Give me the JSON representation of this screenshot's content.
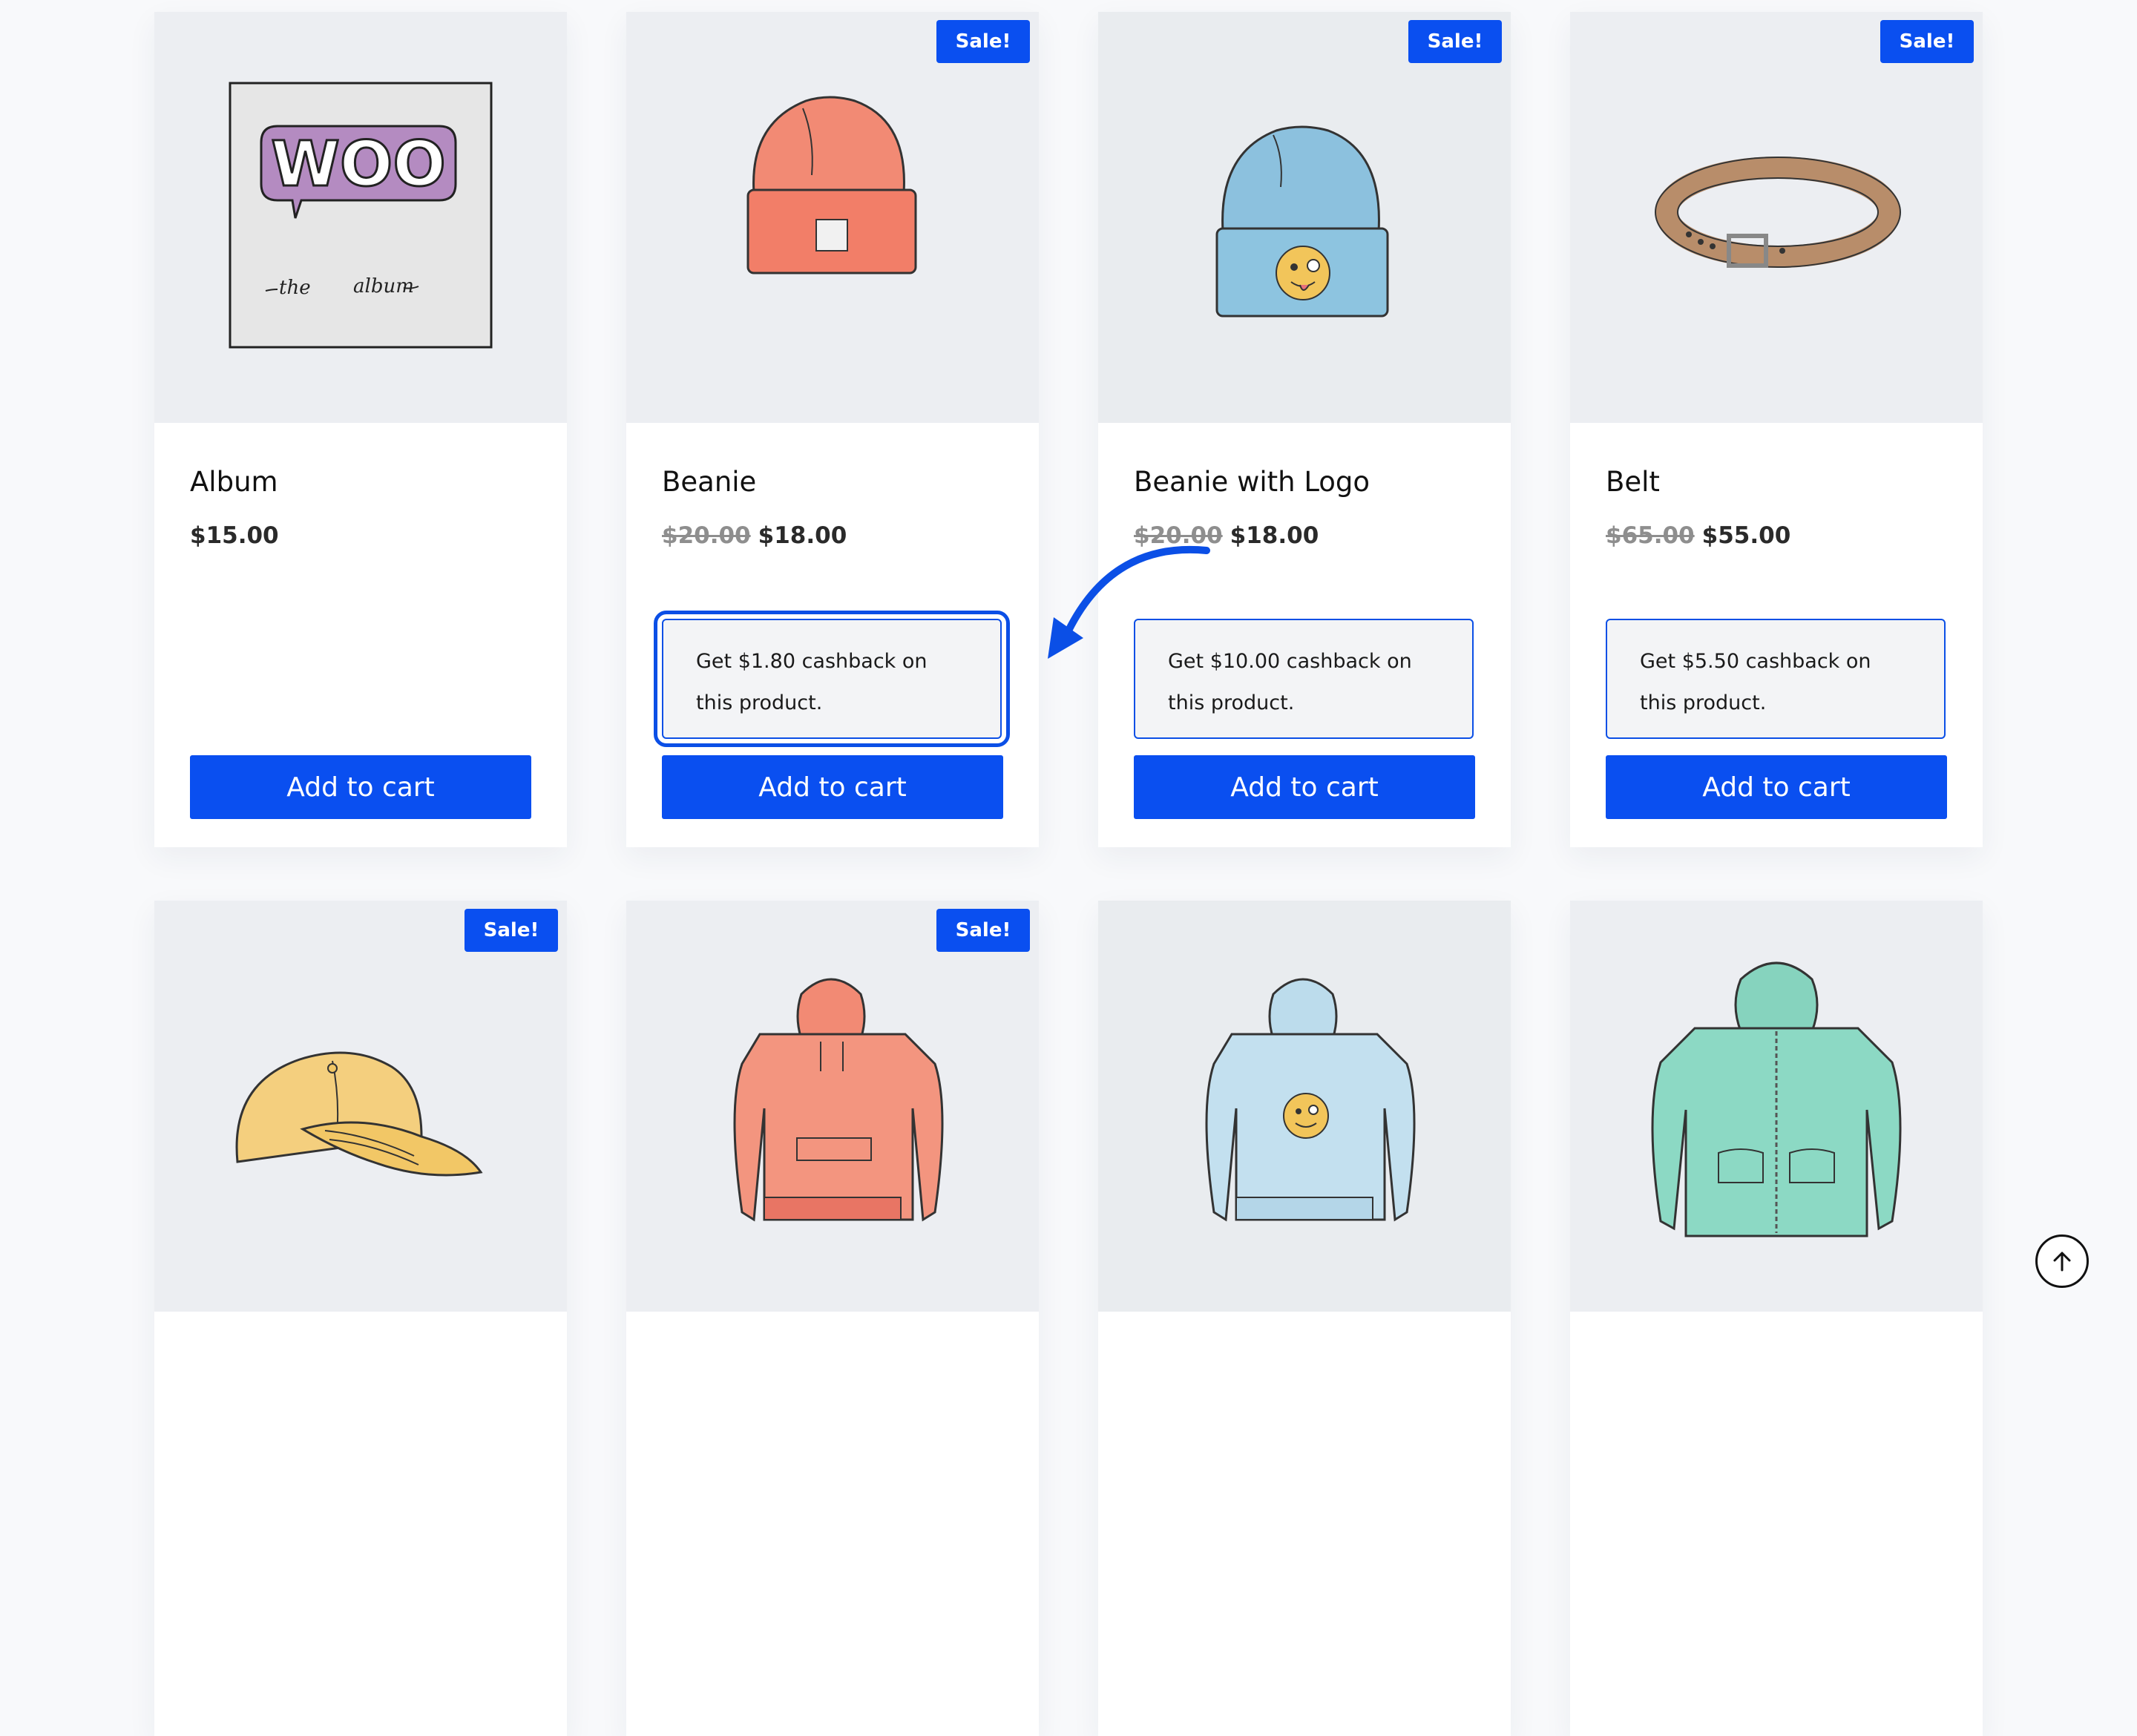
{
  "products": [
    {
      "title": "Album",
      "price": "$15.00",
      "add_to_cart": "Add to cart",
      "illustration": "woo-album-cover",
      "album_text": {
        "logo": "WOO",
        "word1": "the",
        "word2": "album"
      }
    },
    {
      "title": "Beanie",
      "sale_badge": "Sale!",
      "old_price": "$20.00",
      "price": "$18.00",
      "cashback_line1": "Get $1.80 cashback on",
      "cashback_line2": "this product.",
      "add_to_cart": "Add to cart",
      "illustration": "orange-beanie"
    },
    {
      "title": "Beanie with Logo",
      "sale_badge": "Sale!",
      "old_price": "$20.00",
      "price": "$18.00",
      "cashback_line1": "Get $10.00 cashback on",
      "cashback_line2": "this product.",
      "add_to_cart": "Add to cart",
      "illustration": "blue-beanie-with-logo"
    },
    {
      "title": "Belt",
      "sale_badge": "Sale!",
      "old_price": "$65.00",
      "price": "$55.00",
      "cashback_line1": "Get $5.50 cashback on",
      "cashback_line2": "this product.",
      "add_to_cart": "Add to cart",
      "illustration": "leather-belt"
    },
    {
      "sale_badge": "Sale!",
      "illustration": "yellow-cap"
    },
    {
      "sale_badge": "Sale!",
      "illustration": "orange-hoodie"
    },
    {
      "illustration": "blue-hoodie-with-logo"
    },
    {
      "illustration": "green-zip-hoodie"
    }
  ],
  "colors": {
    "accent": "#0a4ff0",
    "old_price": "#8e8e8e",
    "image_bg": "#eceef2"
  },
  "icons": {
    "scroll_to_top": "arrow-up-circle-icon",
    "callout": "curved-arrow-icon"
  }
}
